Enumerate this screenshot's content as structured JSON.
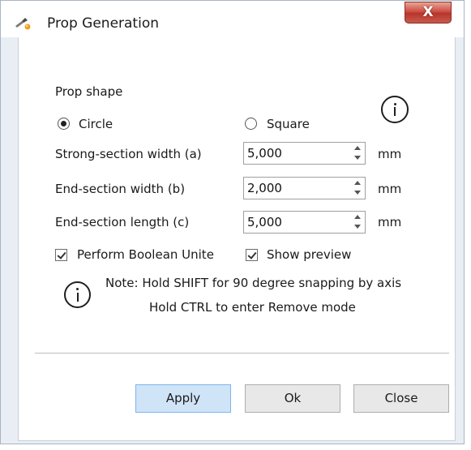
{
  "window": {
    "title": "Prop Generation",
    "icon": "prop-tool-icon",
    "close_glyph": "X"
  },
  "shape": {
    "heading": "Prop shape",
    "options": [
      {
        "label": "Circle",
        "checked": true
      },
      {
        "label": "Square",
        "checked": false
      }
    ]
  },
  "fields": [
    {
      "label": "Strong-section width (a)",
      "value": "5,000",
      "unit": "mm"
    },
    {
      "label": "End-section width (b)",
      "value": "2,000",
      "unit": "mm"
    },
    {
      "label": "End-section length (c)",
      "value": "5,000",
      "unit": "mm"
    }
  ],
  "checkboxes": [
    {
      "label": "Perform Boolean Unite",
      "checked": true
    },
    {
      "label": "Show preview",
      "checked": true
    }
  ],
  "note": {
    "line1": "Note:  Hold SHIFT for 90 degree snapping by axis",
    "line2": "Hold CTRL to enter Remove mode"
  },
  "buttons": {
    "apply": "Apply",
    "ok": "Ok",
    "close": "Close"
  },
  "colors": {
    "primary_button": "#d0e4f8",
    "close_button": "#c9463d"
  }
}
